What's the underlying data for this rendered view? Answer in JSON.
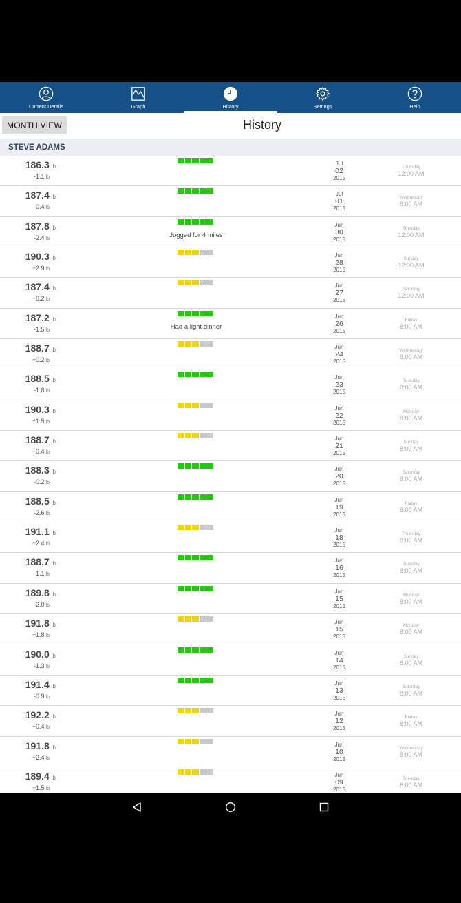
{
  "tabs": [
    {
      "label": "Current Details",
      "icon": "person-circle-icon"
    },
    {
      "label": "Graph",
      "icon": "graph-icon"
    },
    {
      "label": "History",
      "icon": "clock-icon",
      "active": true
    },
    {
      "label": "Settings",
      "icon": "gear-icon"
    },
    {
      "label": "Help",
      "icon": "help-icon"
    }
  ],
  "header": {
    "month_button": "MONTH VIEW",
    "title": "History"
  },
  "user": {
    "name": "STEVE ADAMS"
  },
  "colors": {
    "accent": "#155086",
    "green": "#22c90c",
    "yellow": "#f2d40a",
    "gray": "#c9c9c9"
  },
  "units": {
    "weight": "lb"
  },
  "entries": [
    {
      "weight": "186.3",
      "change": "-1.1",
      "level": 5,
      "note": "",
      "month": "Jul",
      "day": "02",
      "year": "2015",
      "weekday": "Thursday",
      "time": "12:00 AM"
    },
    {
      "weight": "187.4",
      "change": "-0.4",
      "level": 5,
      "note": "",
      "month": "Jul",
      "day": "01",
      "year": "2015",
      "weekday": "Wednesday",
      "time": "8:00 AM"
    },
    {
      "weight": "187.8",
      "change": "-2.4",
      "level": 5,
      "note": "Jogged for 4 miles",
      "month": "Jun",
      "day": "30",
      "year": "2015",
      "weekday": "Tuesday",
      "time": "12:00 AM"
    },
    {
      "weight": "190.3",
      "change": "+2.9",
      "level": 3,
      "note": "",
      "month": "Jun",
      "day": "28",
      "year": "2015",
      "weekday": "Sunday",
      "time": "12:00 AM"
    },
    {
      "weight": "187.4",
      "change": "+0.2",
      "level": 3,
      "note": "",
      "month": "Jun",
      "day": "27",
      "year": "2015",
      "weekday": "Saturday",
      "time": "12:00 AM"
    },
    {
      "weight": "187.2",
      "change": "-1.5",
      "level": 5,
      "note": "Had a light dinner",
      "month": "Jun",
      "day": "26",
      "year": "2015",
      "weekday": "Friday",
      "time": "8:00 AM"
    },
    {
      "weight": "188.7",
      "change": "+0.2",
      "level": 3,
      "note": "",
      "month": "Jun",
      "day": "24",
      "year": "2015",
      "weekday": "Wednesday",
      "time": "8:00 AM"
    },
    {
      "weight": "188.5",
      "change": "-1.8",
      "level": 5,
      "note": "",
      "month": "Jun",
      "day": "23",
      "year": "2015",
      "weekday": "Tuesday",
      "time": "8:00 AM"
    },
    {
      "weight": "190.3",
      "change": "+1.5",
      "level": 3,
      "note": "",
      "month": "Jun",
      "day": "22",
      "year": "2015",
      "weekday": "Monday",
      "time": "8:00 AM"
    },
    {
      "weight": "188.7",
      "change": "+0.4",
      "level": 3,
      "note": "",
      "month": "Jun",
      "day": "21",
      "year": "2015",
      "weekday": "Sunday",
      "time": "8:00 AM"
    },
    {
      "weight": "188.3",
      "change": "-0.2",
      "level": 5,
      "note": "",
      "month": "Jun",
      "day": "20",
      "year": "2015",
      "weekday": "Saturday",
      "time": "8:00 AM"
    },
    {
      "weight": "188.5",
      "change": "-2.6",
      "level": 5,
      "note": "",
      "month": "Jun",
      "day": "19",
      "year": "2015",
      "weekday": "Friday",
      "time": "8:00 AM"
    },
    {
      "weight": "191.1",
      "change": "+2.4",
      "level": 3,
      "note": "",
      "month": "Jun",
      "day": "18",
      "year": "2015",
      "weekday": "Thursday",
      "time": "8:00 AM"
    },
    {
      "weight": "188.7",
      "change": "-1.1",
      "level": 5,
      "note": "",
      "month": "Jun",
      "day": "16",
      "year": "2015",
      "weekday": "Tuesday",
      "time": "8:00 AM"
    },
    {
      "weight": "189.8",
      "change": "-2.0",
      "level": 5,
      "note": "",
      "month": "Jun",
      "day": "15",
      "year": "2015",
      "weekday": "Monday",
      "time": "8:00 AM"
    },
    {
      "weight": "191.8",
      "change": "+1.8",
      "level": 3,
      "note": "",
      "month": "Jun",
      "day": "15",
      "year": "2015",
      "weekday": "Monday",
      "time": "8:00 AM"
    },
    {
      "weight": "190.0",
      "change": "-1.3",
      "level": 5,
      "note": "",
      "month": "Jun",
      "day": "14",
      "year": "2015",
      "weekday": "Sunday",
      "time": "8:00 AM"
    },
    {
      "weight": "191.4",
      "change": "-0.9",
      "level": 5,
      "note": "",
      "month": "Jun",
      "day": "13",
      "year": "2015",
      "weekday": "Saturday",
      "time": "8:00 AM"
    },
    {
      "weight": "192.2",
      "change": "+0.4",
      "level": 3,
      "note": "",
      "month": "Jun",
      "day": "12",
      "year": "2015",
      "weekday": "Friday",
      "time": "8:00 AM"
    },
    {
      "weight": "191.8",
      "change": "+2.4",
      "level": 3,
      "note": "",
      "month": "Jun",
      "day": "10",
      "year": "2015",
      "weekday": "Wednesday",
      "time": "8:00 AM"
    },
    {
      "weight": "189.4",
      "change": "+1.5",
      "level": 3,
      "note": "",
      "month": "Jun",
      "day": "09",
      "year": "2015",
      "weekday": "Tuesday",
      "time": "8:00 AM"
    }
  ],
  "nav": [
    {
      "icon": "back-icon"
    },
    {
      "icon": "home-icon"
    },
    {
      "icon": "recents-icon"
    }
  ]
}
